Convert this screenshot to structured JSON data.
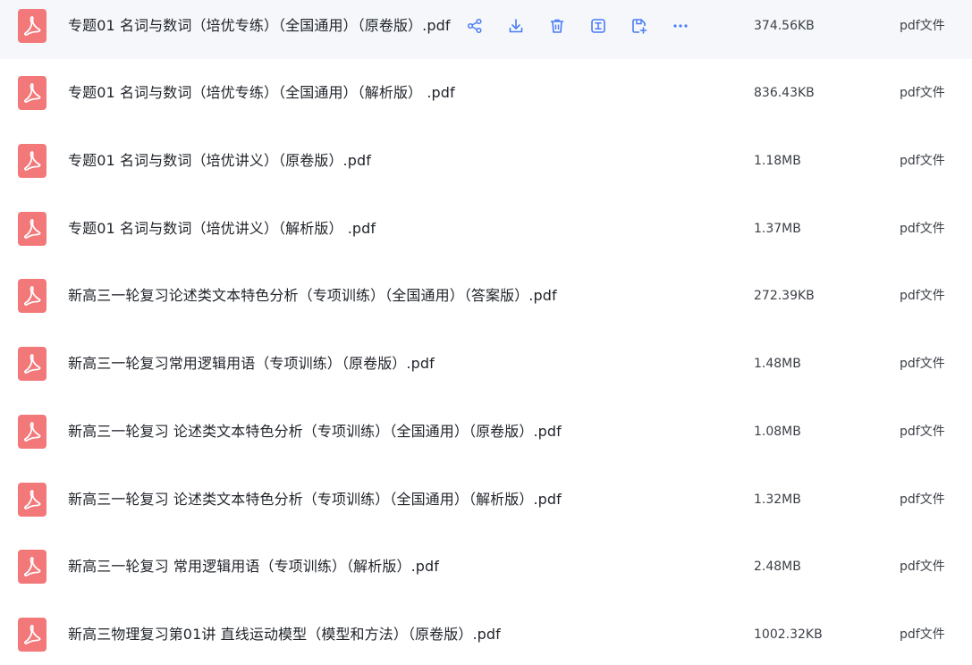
{
  "colors": {
    "pdf_icon": "#f2787a",
    "action_icon": "#4a7cf7",
    "hover_row_bg": "#f5f7fa"
  },
  "row_actions": [
    {
      "icon": "share-icon"
    },
    {
      "icon": "download-icon"
    },
    {
      "icon": "delete-icon"
    },
    {
      "icon": "text-cursor-icon"
    },
    {
      "icon": "copy-to-icon"
    },
    {
      "icon": "more-icon"
    }
  ],
  "files": [
    {
      "name": "专题01 名词与数词（培优专练）（全国通用）（原卷版）.pdf",
      "size": "374.56KB",
      "type": "pdf文件",
      "hovered": true
    },
    {
      "name": "专题01 名词与数词（培优专练）（全国通用）（解析版） .pdf",
      "size": "836.43KB",
      "type": "pdf文件"
    },
    {
      "name": "专题01 名词与数词（培优讲义）（原卷版）.pdf",
      "size": "1.18MB",
      "type": "pdf文件"
    },
    {
      "name": "专题01 名词与数词（培优讲义）（解析版） .pdf",
      "size": "1.37MB",
      "type": "pdf文件"
    },
    {
      "name": "新高三一轮复习论述类文本特色分析（专项训练）（全国通用）（答案版）.pdf",
      "size": "272.39KB",
      "type": "pdf文件"
    },
    {
      "name": "新高三一轮复习常用逻辑用语（专项训练）（原卷版）.pdf",
      "size": "1.48MB",
      "type": "pdf文件"
    },
    {
      "name": "新高三一轮复习 论述类文本特色分析（专项训练）（全国通用）（原卷版）.pdf",
      "size": "1.08MB",
      "type": "pdf文件"
    },
    {
      "name": "新高三一轮复习 论述类文本特色分析（专项训练）（全国通用）（解析版）.pdf",
      "size": "1.32MB",
      "type": "pdf文件"
    },
    {
      "name": "新高三一轮复习 常用逻辑用语（专项训练）（解析版）.pdf",
      "size": "2.48MB",
      "type": "pdf文件"
    },
    {
      "name": "新高三物理复习第01讲 直线运动模型（模型和方法）（原卷版）.pdf",
      "size": "1002.32KB",
      "type": "pdf文件"
    }
  ]
}
